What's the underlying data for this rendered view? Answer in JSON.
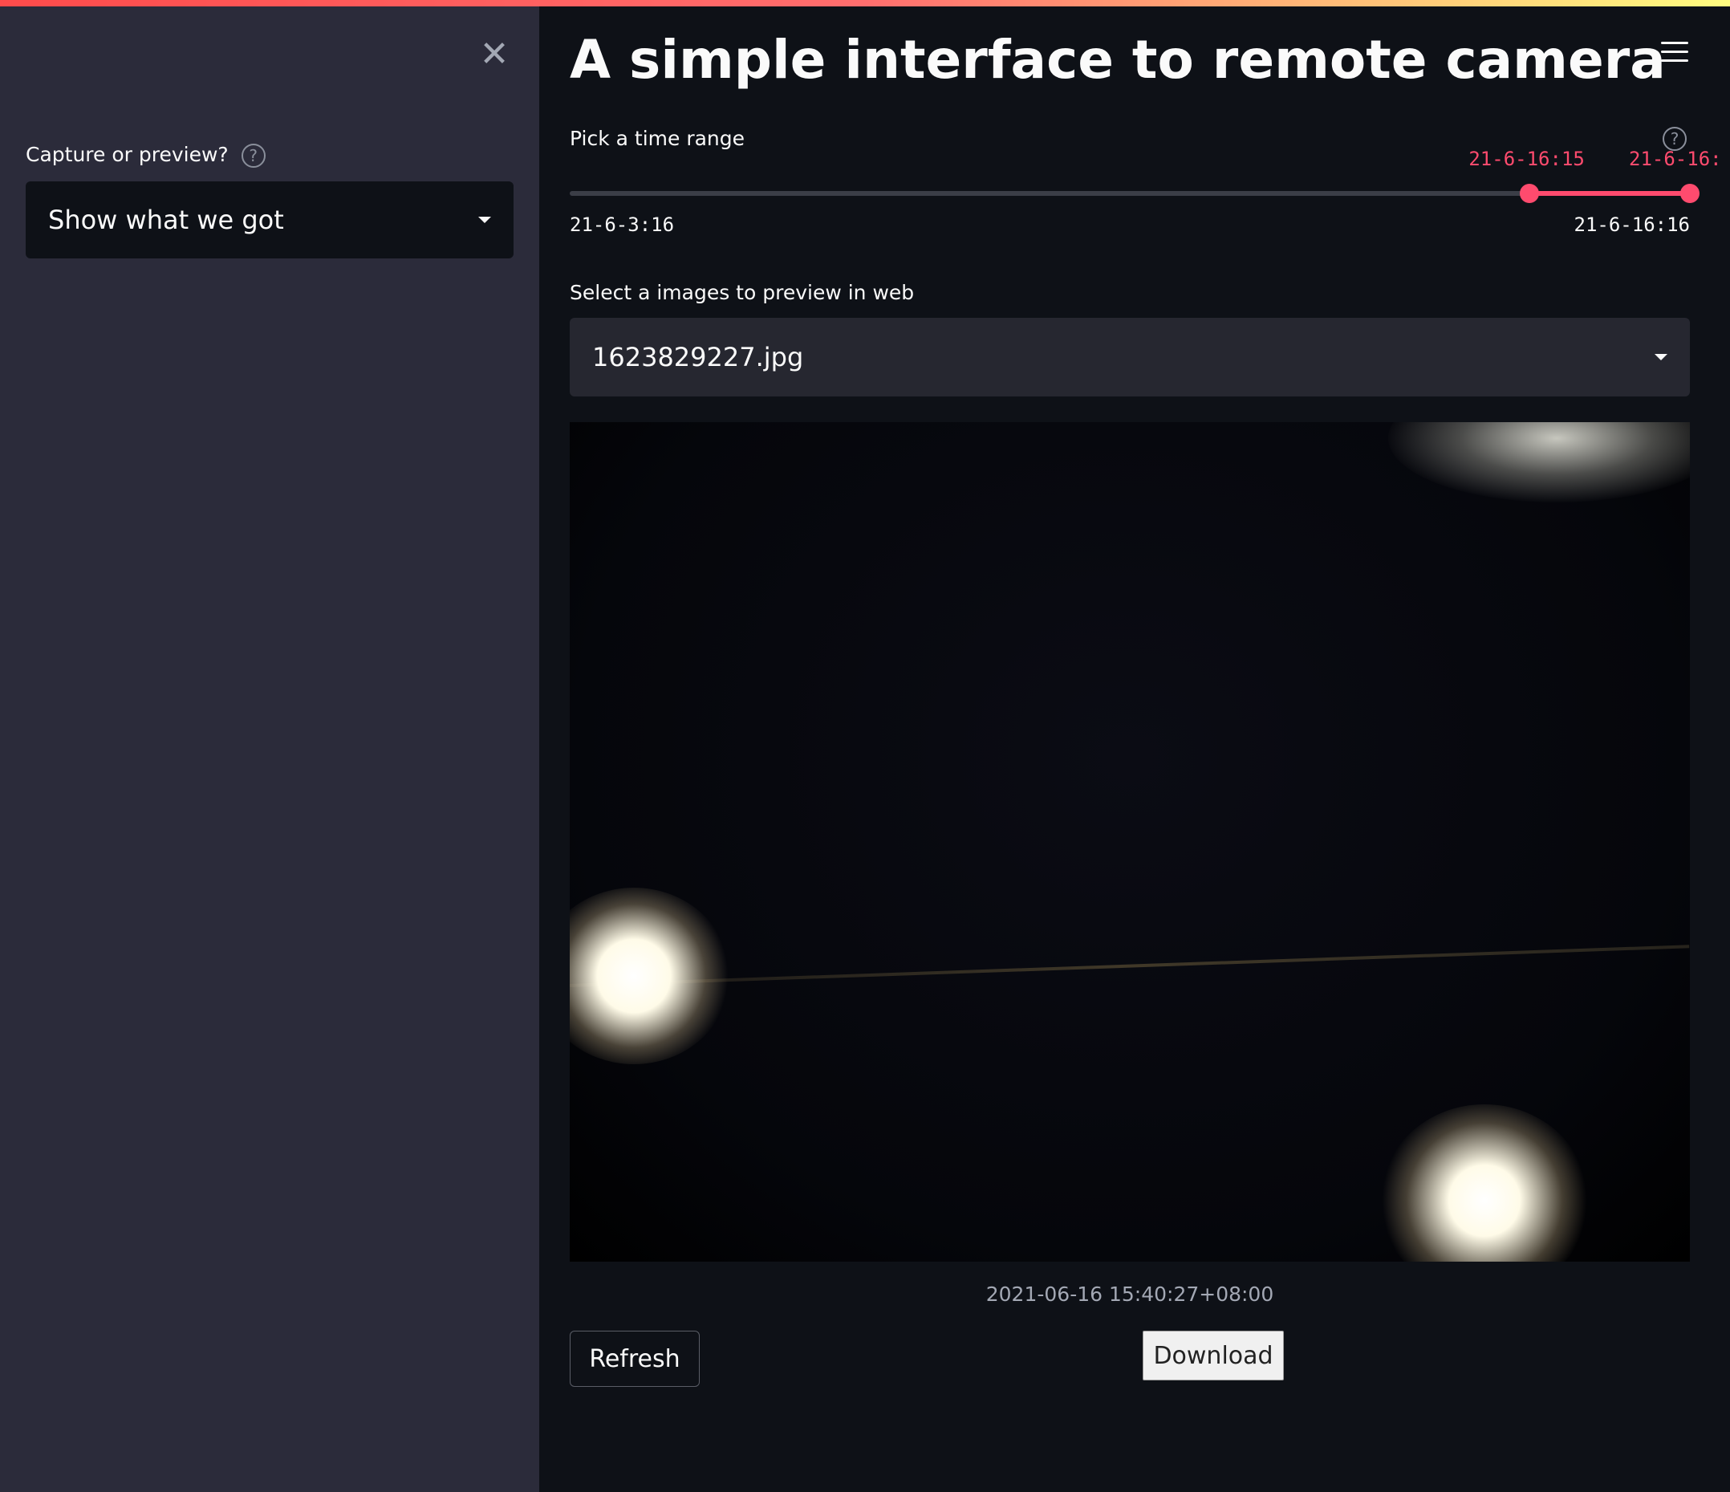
{
  "sidebar": {
    "close_symbol": "✕",
    "label": "Capture or preview?",
    "help_symbol": "?",
    "select_value": "Show what we got"
  },
  "main": {
    "title": "A simple interface to remote camera",
    "range": {
      "label": "Pick a time range",
      "help_symbol": "?",
      "min_label": "21-6-3:16",
      "max_label": "21-6-16:16",
      "low_thumb_label": "21-6-16:15",
      "high_thumb_label": "21-6-16:",
      "low_fraction": 0.857,
      "high_fraction": 1.0
    },
    "image_select": {
      "label": "Select a images to preview in web",
      "value": "1623829227.jpg"
    },
    "image_caption": "2021-06-16 15:40:27+08:00",
    "refresh_label": "Refresh",
    "download_label": "Download"
  },
  "colors": {
    "accent": "#ff4b6e",
    "sidebar_bg": "#2b2b3a",
    "main_bg": "#0e1117"
  }
}
